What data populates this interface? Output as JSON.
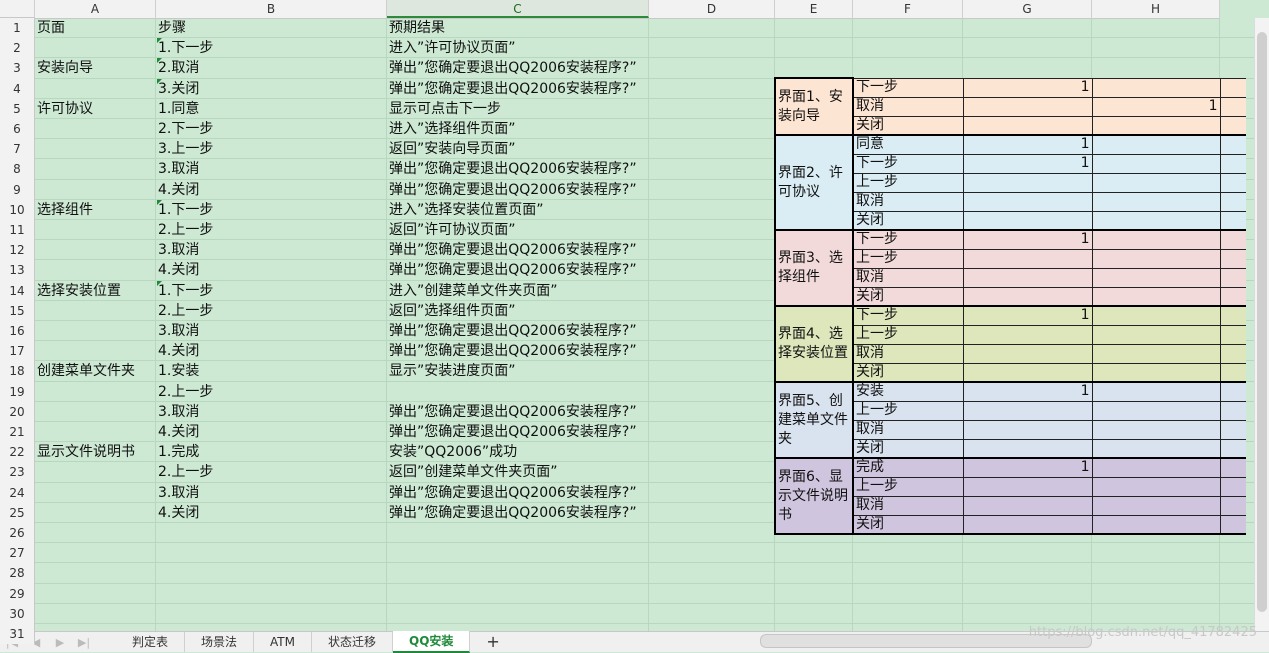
{
  "columns": [
    "A",
    "B",
    "C",
    "D",
    "E",
    "F",
    "G",
    "H"
  ],
  "selected_column": "C",
  "rows": [
    "1",
    "2",
    "3",
    "4",
    "5",
    "6",
    "7",
    "8",
    "9",
    "10",
    "11",
    "12",
    "13",
    "14",
    "15",
    "16",
    "17",
    "18",
    "19",
    "20",
    "21",
    "22",
    "23",
    "24",
    "25",
    "26",
    "27",
    "28",
    "29",
    "30",
    "31"
  ],
  "col_a": {
    "1": "页面",
    "3": "安装向导",
    "5": "许可协议",
    "10": "选择组件",
    "14": "选择安装位置",
    "18": "创建菜单文件夹",
    "22": "显示文件说明书"
  },
  "col_b": {
    "1": "步骤",
    "2": "1.下一步",
    "3": "2.取消",
    "4": "3.关闭",
    "5": "1.同意",
    "6": "2.下一步",
    "7": "3.上一步",
    "8": "3.取消",
    "9": "4.关闭",
    "10": "1.下一步",
    "11": "2.上一步",
    "12": "3.取消",
    "13": "4.关闭",
    "14": "1.下一步",
    "15": "2.上一步",
    "16": "3.取消",
    "17": "4.关闭",
    "18": "1.安装",
    "19": "2.上一步",
    "20": "3.取消",
    "21": "4.关闭",
    "22": "1.完成",
    "23": "2.上一步",
    "24": "3.取消",
    "25": "4.关闭"
  },
  "col_c": {
    "1": "预期结果",
    "2": "进入”许可协议页面”",
    "3": "弹出”您确定要退出QQ2006安装程序?”",
    "4": "弹出”您确定要退出QQ2006安装程序?”",
    "5": "显示可点击下一步",
    "6": "进入”选择组件页面”",
    "7": "返回”安装向导页面”",
    "8": "弹出”您确定要退出QQ2006安装程序?”",
    "9": "弹出”您确定要退出QQ2006安装程序?”",
    "10": "进入”选择安装位置页面”",
    "11": "返回”许可协议页面”",
    "12": "弹出”您确定要退出QQ2006安装程序?”",
    "13": "弹出”您确定要退出QQ2006安装程序?”",
    "14": "进入”创建菜单文件夹页面”",
    "15": "返回”选择组件页面”",
    "16": "弹出”您确定要退出QQ2006安装程序?”",
    "17": "弹出”您确定要退出QQ2006安装程序?”",
    "18": "显示”安装进度页面”",
    "20": "弹出”您确定要退出QQ2006安装程序?”",
    "21": "弹出”您确定要退出QQ2006安装程序?”",
    "22": "安装”QQ2006”成功",
    "23": "返回”创建菜单文件夹页面”",
    "24": "弹出”您确定要退出QQ2006安装程序?”",
    "25": "弹出”您确定要退出QQ2006安装程序?”"
  },
  "matrix": [
    {
      "name": "界面1、安装向导",
      "color": "#fde5d3",
      "actions": [
        {
          "label": "下一步",
          "g": "1",
          "h": ""
        },
        {
          "label": "取消",
          "g": "",
          "h": "1"
        },
        {
          "label": "关闭",
          "g": "",
          "h": ""
        }
      ]
    },
    {
      "name": "界面2、许可协议",
      "color": "#daedf4",
      "actions": [
        {
          "label": "同意",
          "g": "1",
          "h": ""
        },
        {
          "label": "下一步",
          "g": "1",
          "h": ""
        },
        {
          "label": "上一步",
          "g": "",
          "h": ""
        },
        {
          "label": "取消",
          "g": "",
          "h": ""
        },
        {
          "label": "关闭",
          "g": "",
          "h": ""
        }
      ]
    },
    {
      "name": "界面3、选择组件",
      "color": "#f3dada",
      "actions": [
        {
          "label": "下一步",
          "g": "1",
          "h": ""
        },
        {
          "label": "上一步",
          "g": "",
          "h": ""
        },
        {
          "label": "取消",
          "g": "",
          "h": ""
        },
        {
          "label": "关闭",
          "g": "",
          "h": ""
        }
      ]
    },
    {
      "name": "界面4、选择安装位置",
      "color": "#dde7bb",
      "actions": [
        {
          "label": "下一步",
          "g": "1",
          "h": ""
        },
        {
          "label": "上一步",
          "g": "",
          "h": ""
        },
        {
          "label": "取消",
          "g": "",
          "h": ""
        },
        {
          "label": "关闭",
          "g": "",
          "h": ""
        }
      ]
    },
    {
      "name": "界面5、创建菜单文件夹",
      "color": "#d9e2ef",
      "actions": [
        {
          "label": "安装",
          "g": "1",
          "h": ""
        },
        {
          "label": "上一步",
          "g": "",
          "h": ""
        },
        {
          "label": "取消",
          "g": "",
          "h": ""
        },
        {
          "label": "关闭",
          "g": "",
          "h": ""
        }
      ]
    },
    {
      "name": "界面6、显示文件说明书",
      "color": "#d0c5de",
      "actions": [
        {
          "label": "完成",
          "g": "1",
          "h": ""
        },
        {
          "label": "上一步",
          "g": "",
          "h": ""
        },
        {
          "label": "取消",
          "g": "",
          "h": ""
        },
        {
          "label": "关闭",
          "g": "",
          "h": ""
        }
      ]
    }
  ],
  "sheet_tabs": [
    "判定表",
    "场景法",
    "ATM",
    "状态迁移",
    "QQ安装"
  ],
  "active_tab": "QQ安装",
  "add_tab_label": "+",
  "watermark": "https://blog.csdn.net/qq_41782425"
}
